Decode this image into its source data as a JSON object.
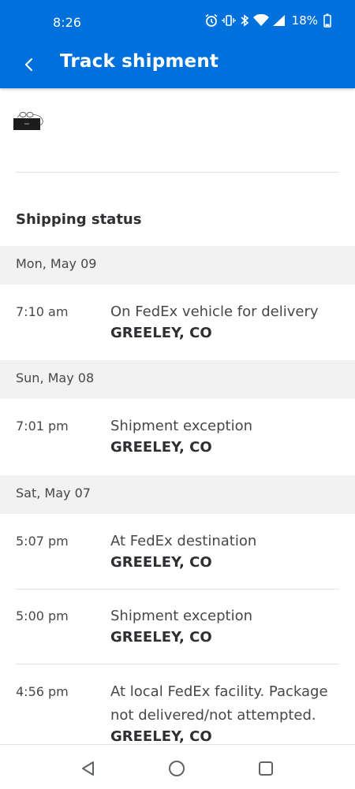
{
  "status_bar": {
    "time": "8:26",
    "battery": "18%",
    "icons": [
      "alarm-icon",
      "vibrate-icon",
      "bluetooth-icon",
      "wifi-icon",
      "signal-icon",
      "battery-icon"
    ]
  },
  "app_bar": {
    "title": "Track shipment",
    "color": "#0071dc"
  },
  "shipping": {
    "heading": "Shipping status",
    "groups": [
      {
        "date": "Mon, May 09",
        "events": [
          {
            "time": "7:10 am",
            "description": "On FedEx vehicle for delivery",
            "location": "GREELEY, CO"
          }
        ]
      },
      {
        "date": "Sun, May 08",
        "events": [
          {
            "time": "7:01 pm",
            "description": "Shipment exception",
            "location": "GREELEY, CO"
          }
        ]
      },
      {
        "date": "Sat, May 07",
        "events": [
          {
            "time": "5:07 pm",
            "description": "At FedEx destination",
            "location": "GREELEY, CO"
          },
          {
            "time": "5:00 pm",
            "description": "Shipment exception",
            "location": "GREELEY, CO"
          },
          {
            "time": "4:56 pm",
            "description": "At local FedEx facility.  Package not delivered/not attempted.",
            "location": "GREELEY, CO"
          }
        ]
      }
    ]
  },
  "nav_bar": {
    "buttons": [
      "back-triangle-icon",
      "home-circle-icon",
      "recents-square-icon"
    ]
  }
}
